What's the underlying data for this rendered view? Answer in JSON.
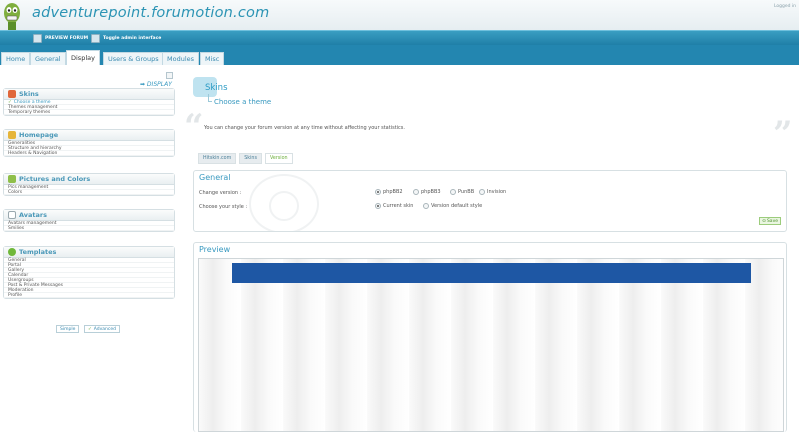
{
  "header": {
    "site_title": "adventurepoint.forumotion.com",
    "logged_in": "Logged in"
  },
  "toolbar": {
    "preview_label": "PREVIEW FORUM",
    "toggle_label": "Toggle admin interface"
  },
  "tabs": [
    {
      "label": "Home"
    },
    {
      "label": "General"
    },
    {
      "label": "Display",
      "active": true
    },
    {
      "label": "Users & Groups"
    },
    {
      "label": "Modules"
    },
    {
      "label": "Misc"
    }
  ],
  "sidebar": {
    "section_label": "➡ DISPLAY",
    "panels": [
      {
        "title": "Skins",
        "icon": "palette-icon",
        "items": [
          "Choose a theme",
          "Themes management",
          "Temporary themes"
        ]
      },
      {
        "title": "Homepage",
        "icon": "home-icon",
        "items": [
          "Generalities",
          "Structure and hierarchy",
          "Headers & Navigation"
        ]
      },
      {
        "title": "Pictures and Colors",
        "icon": "picture-icon",
        "items": [
          "Pics management",
          "Colors"
        ]
      },
      {
        "title": "Avatars",
        "icon": "avatar-icon",
        "items": [
          "Avatars management",
          "Smilies"
        ]
      },
      {
        "title": "Templates",
        "icon": "templates-icon",
        "items": [
          "General",
          "Portal",
          "Gallery",
          "Calendar",
          "Usergroups",
          "Post & Private Messages",
          "Moderation",
          "Profile"
        ]
      }
    ],
    "simple_label": "Simple",
    "advanced_label": "Advanced"
  },
  "main": {
    "title": "Skins",
    "subtitle": "Choose a theme",
    "intro": "You can change your forum version at any time without affecting your statistics.",
    "subtabs": [
      {
        "label": "Hitskin.com"
      },
      {
        "label": "Skins"
      },
      {
        "label": "Version",
        "active": true
      }
    ],
    "general": {
      "title": "General",
      "change_version_label": "Change version :",
      "versions": [
        "phpBB2",
        "phpBB3",
        "PunBB",
        "Invision"
      ],
      "selected_version": "phpBB2",
      "choose_style_label": "Choose your style :",
      "styles": [
        "Current skin",
        "Version default style"
      ],
      "selected_style": "Current skin",
      "save_label": "Save"
    },
    "preview": {
      "title": "Preview",
      "banner_color": "#1e57a4"
    }
  },
  "colors": {
    "accent": "#2c94b4",
    "toolbar": "#2386b0",
    "save_green": "#4b8f2a"
  }
}
